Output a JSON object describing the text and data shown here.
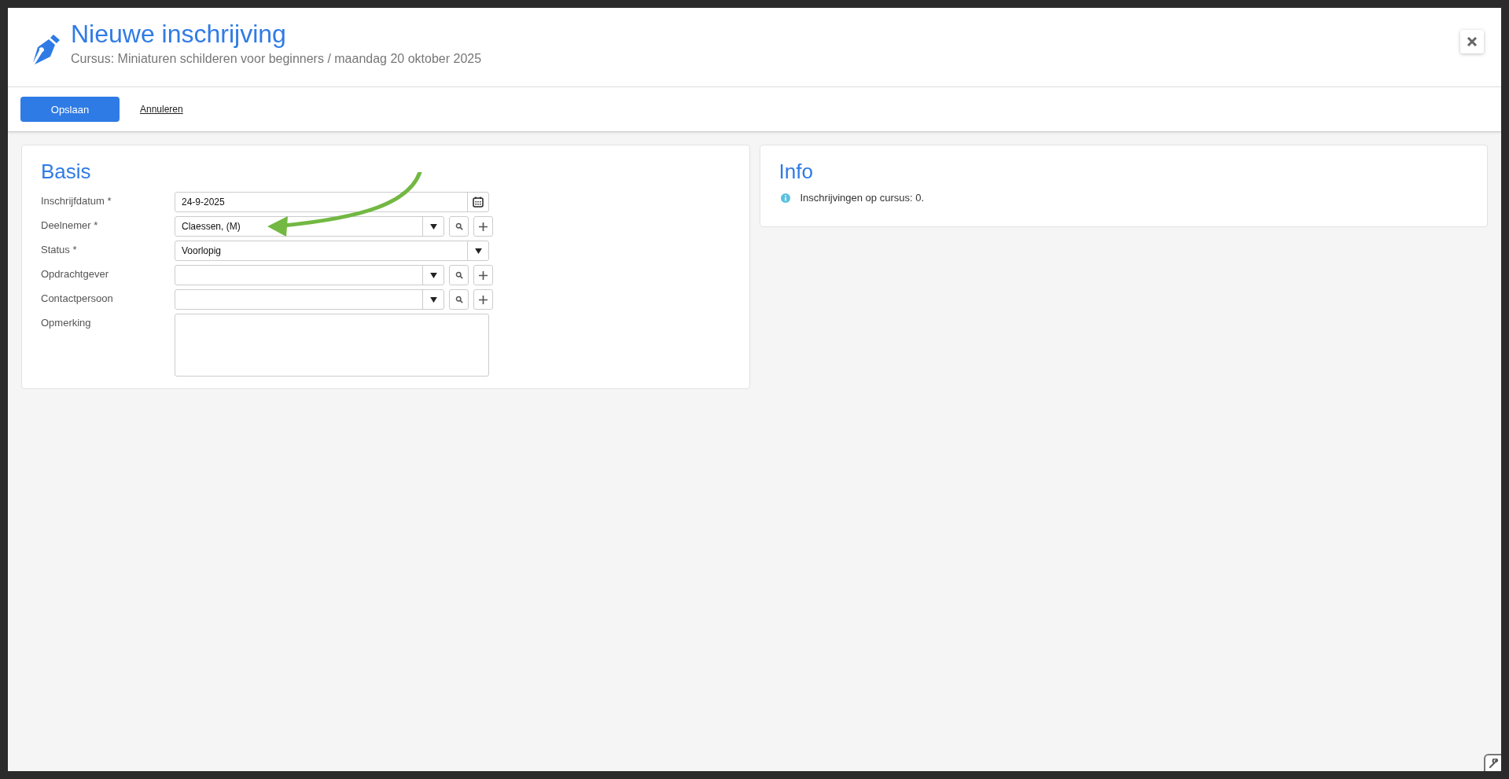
{
  "header": {
    "title": "Nieuwe inschrijving",
    "subtitle": "Cursus: Miniaturen schilderen voor beginners / maandag 20 oktober 2025"
  },
  "toolbar": {
    "save": "Opslaan",
    "cancel": "Annuleren"
  },
  "basis": {
    "title": "Basis",
    "fields": [
      {
        "kind": "date",
        "label": "Inschrijfdatum *",
        "value": "24-9-2025"
      },
      {
        "kind": "lookup",
        "label": "Deelnemer *",
        "value": "Claessen,  (M)"
      },
      {
        "kind": "select",
        "label": "Status *",
        "value": "Voorlopig"
      },
      {
        "kind": "lookup",
        "label": "Opdrachtgever"
      },
      {
        "kind": "lookup",
        "label": "Contactpersoon"
      },
      {
        "kind": "textarea",
        "label": "Opmerking"
      }
    ]
  },
  "info": {
    "title": "Info",
    "lines": [
      "Inschrijvingen op cursus: 0."
    ]
  }
}
